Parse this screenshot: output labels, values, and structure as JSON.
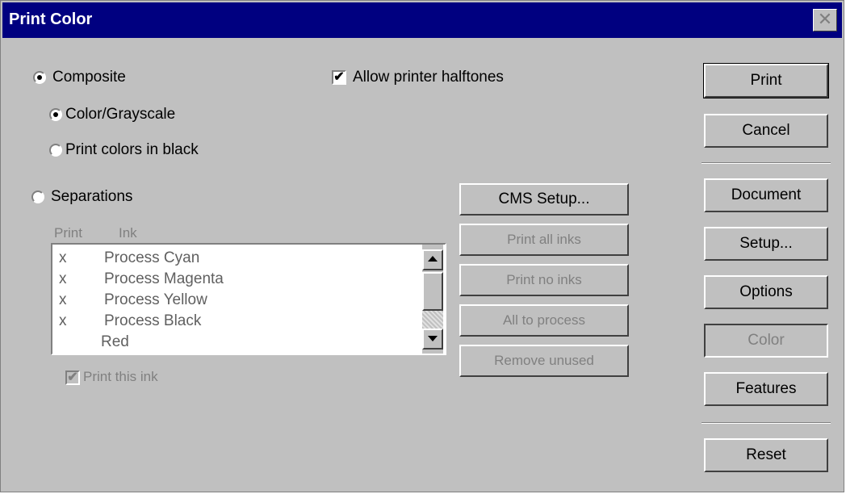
{
  "window": {
    "title": "Print Color",
    "close_glyph": "✕"
  },
  "composite": {
    "label": "Composite",
    "selected": true
  },
  "color_grayscale": {
    "label": "Color/Grayscale",
    "selected": true
  },
  "print_black": {
    "label": "Print colors in black",
    "selected": false
  },
  "separations": {
    "label": "Separations",
    "selected": false
  },
  "allow_halftones": {
    "label": "Allow printer halftones",
    "checked": true
  },
  "inks": {
    "col_print": "Print",
    "col_ink": "Ink",
    "items": [
      {
        "mark": "x",
        "name": "Process Cyan"
      },
      {
        "mark": "x",
        "name": "Process Magenta"
      },
      {
        "mark": "x",
        "name": "Process Yellow"
      },
      {
        "mark": "x",
        "name": "Process Black"
      },
      {
        "mark": "",
        "name": "Red"
      }
    ]
  },
  "print_this_ink": {
    "label": "Print this ink",
    "checked": true
  },
  "middle_buttons": {
    "cms_setup": "CMS Setup...",
    "print_all": "Print all inks",
    "print_none": "Print no inks",
    "all_process": "All to process",
    "remove_unused": "Remove unused"
  },
  "right_buttons": {
    "print": "Print",
    "cancel": "Cancel",
    "document": "Document",
    "setup": "Setup...",
    "options": "Options",
    "color": "Color",
    "features": "Features",
    "reset": "Reset"
  },
  "icons": {
    "scroll_up": "up-arrow-icon",
    "scroll_down": "down-arrow-icon",
    "checkmark": "checkmark-icon"
  }
}
